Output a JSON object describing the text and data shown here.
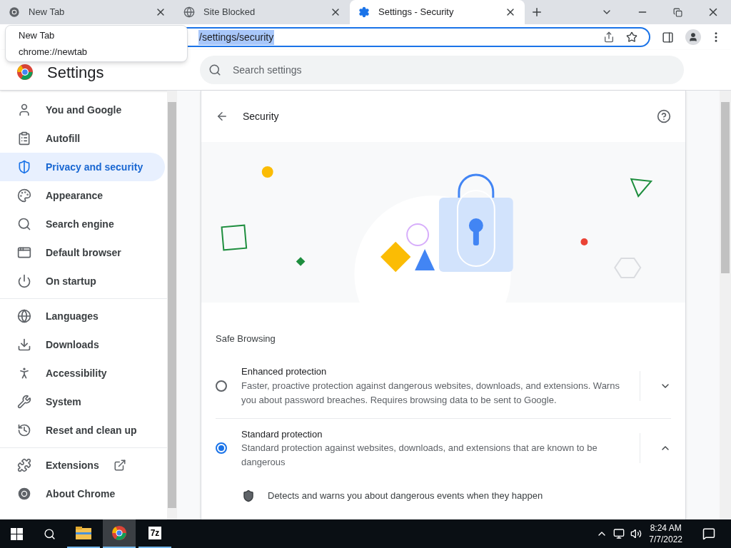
{
  "tabs": [
    {
      "title": "New Tab",
      "selected": false
    },
    {
      "title": "Site Blocked",
      "selected": false
    },
    {
      "title": "Settings - Security",
      "selected": true
    }
  ],
  "address_bar": {
    "value": "/settings/security"
  },
  "tooltip": {
    "title": "New Tab",
    "url": "chrome://newtab"
  },
  "settings_header": {
    "title": "Settings",
    "search_placeholder": "Search settings"
  },
  "sidebar": {
    "groups": [
      [
        {
          "label": "You and Google",
          "selected": false,
          "external": false
        },
        {
          "label": "Autofill",
          "selected": false,
          "external": false
        },
        {
          "label": "Privacy and security",
          "selected": true,
          "external": false
        },
        {
          "label": "Appearance",
          "selected": false,
          "external": false
        },
        {
          "label": "Search engine",
          "selected": false,
          "external": false
        },
        {
          "label": "Default browser",
          "selected": false,
          "external": false
        },
        {
          "label": "On startup",
          "selected": false,
          "external": false
        }
      ],
      [
        {
          "label": "Languages",
          "selected": false,
          "external": false
        },
        {
          "label": "Downloads",
          "selected": false,
          "external": false
        },
        {
          "label": "Accessibility",
          "selected": false,
          "external": false
        },
        {
          "label": "System",
          "selected": false,
          "external": false
        },
        {
          "label": "Reset and clean up",
          "selected": false,
          "external": false
        }
      ],
      [
        {
          "label": "Extensions",
          "selected": false,
          "external": true
        },
        {
          "label": "About Chrome",
          "selected": false,
          "external": false
        }
      ]
    ]
  },
  "page": {
    "title": "Security",
    "section": "Safe Browsing",
    "options": [
      {
        "title": "Enhanced protection",
        "description": "Faster, proactive protection against dangerous websites, downloads, and extensions. Warns you about password breaches. Requires browsing data to be sent to Google.",
        "selected": false,
        "expanded": false
      },
      {
        "title": "Standard protection",
        "description": "Standard protection against websites, downloads, and extensions that are known to be dangerous",
        "selected": true,
        "expanded": true
      }
    ],
    "details": [
      "Detects and warns you about dangerous events when they happen"
    ]
  },
  "taskbar": {
    "apps": [
      {
        "kind": "explorer",
        "active": false
      },
      {
        "kind": "chrome",
        "active": true
      },
      {
        "kind": "archiver",
        "label": "7z",
        "active": false
      }
    ],
    "time": "8:24 AM",
    "date": "7/7/2022"
  }
}
